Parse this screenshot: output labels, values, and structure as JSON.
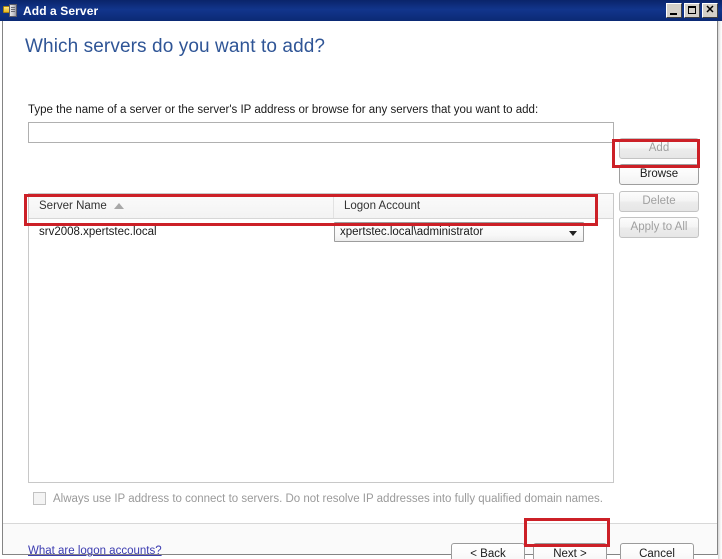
{
  "window": {
    "title": "Add a Server",
    "icon": "server-icon",
    "controls": {
      "minimize": "_",
      "maximize": "❐",
      "close": "✕"
    }
  },
  "page": {
    "heading": "Which servers do you want to add?",
    "instruction": "Type the name of a server or the server's IP address or browse for any servers that you want to add:"
  },
  "server_input": {
    "value": "",
    "placeholder": ""
  },
  "side_buttons": [
    {
      "id": "add",
      "label": "Add",
      "enabled": false
    },
    {
      "id": "browse",
      "label": "Browse",
      "enabled": true
    },
    {
      "id": "delete",
      "label": "Delete",
      "enabled": false
    },
    {
      "id": "apply_to_all",
      "label": "Apply to All",
      "enabled": false
    }
  ],
  "grid": {
    "columns": [
      {
        "key": "server_name",
        "label": "Server Name",
        "sort": "ascending"
      },
      {
        "key": "logon_account",
        "label": "Logon Account",
        "sort": "none"
      }
    ],
    "rows": [
      {
        "server_name": "srv2008.xpertstec.local",
        "logon_account": "xpertstec.local\\administrator"
      }
    ]
  },
  "checkbox": {
    "label": "Always use IP address to connect to servers. Do not resolve IP addresses into fully qualified domain names.",
    "checked": false,
    "enabled": false
  },
  "footer": {
    "help_link": "What are logon accounts?",
    "back_label": "< Back",
    "next_label": "Next >",
    "cancel_label": "Cancel"
  },
  "highlights": {
    "color": "#cc2027",
    "targets": [
      "browse-button",
      "grid-row-0",
      "next-button"
    ]
  },
  "colors": {
    "titlebar": "#0a246a",
    "heading": "#2f5596",
    "link": "#3b3bb0",
    "highlight": "#cc2027",
    "disabled_text": "#a0a0a0"
  }
}
